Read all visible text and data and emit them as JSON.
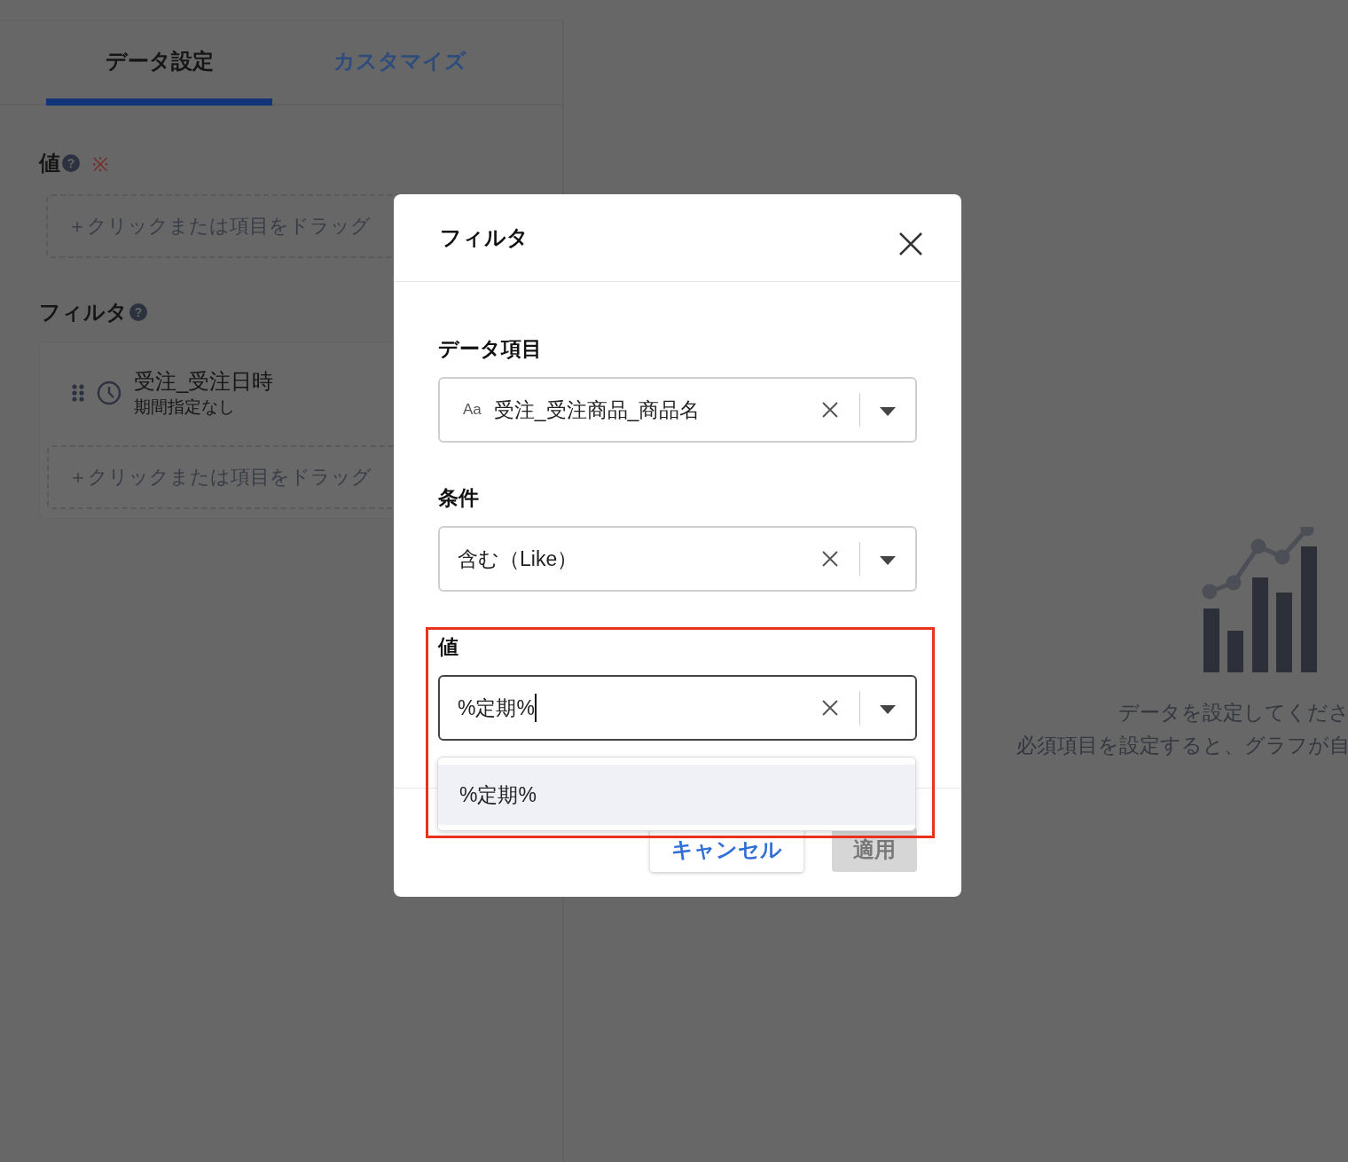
{
  "tabs": [
    {
      "label": "データ設定",
      "selected": true
    },
    {
      "label": "カスタマイズ",
      "selected": false
    }
  ],
  "value_section": {
    "label": "値",
    "help_mark": "?",
    "required_mark": "※",
    "drop_placeholder": "＋クリックまたは項目をドラッグ"
  },
  "filter_section": {
    "label": "フィルタ",
    "help_mark": "?",
    "filters": [
      {
        "name": "受注_受注日時",
        "detail": "期間指定なし"
      }
    ],
    "drop_placeholder": "＋クリックまたは項目をドラッグ"
  },
  "empty_state": {
    "title": "データを設定してくださ",
    "message": "必須項目を設定すると、グラフが自"
  },
  "dialog": {
    "title": "フィルタ",
    "fields": [
      {
        "label": "データ項目",
        "type_icon": "Aa",
        "value": "受注_受注商品_商品名",
        "focused": false
      },
      {
        "label": "条件",
        "value": "含む（Like）",
        "focused": false
      },
      {
        "label": "値",
        "value": "%定期%",
        "focused": true
      }
    ],
    "suggestions": [
      {
        "label": "%定期%",
        "selected": true
      }
    ],
    "buttons": [
      {
        "label": "キャンセル",
        "kind": "secondary",
        "disabled": false
      },
      {
        "label": "適用",
        "kind": "primary",
        "disabled": true
      }
    ]
  }
}
